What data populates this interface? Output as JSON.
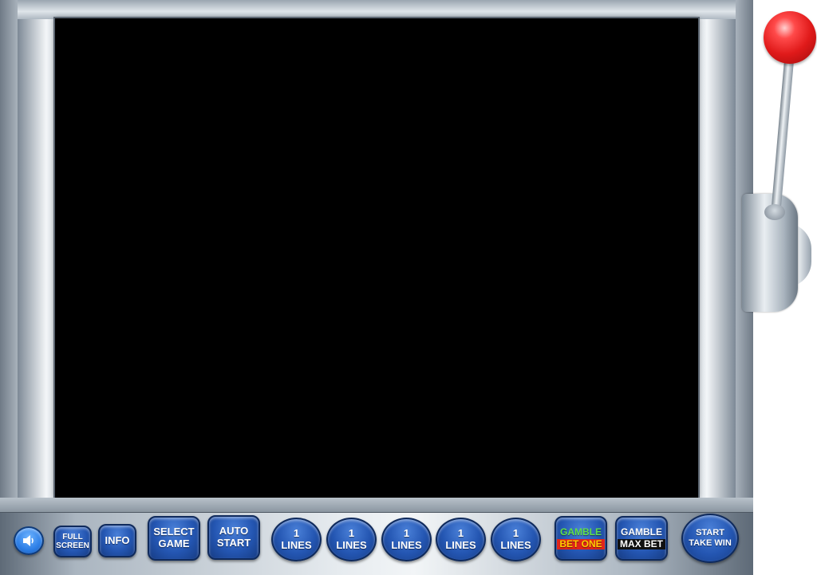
{
  "buttons": {
    "full_screen": [
      "FULL",
      "SCREEN"
    ],
    "info": "INFO",
    "select_game": [
      "SELECT",
      "GAME"
    ],
    "auto_start": [
      "AUTO",
      "START"
    ],
    "lines": [
      {
        "value": "1",
        "label": "LINES"
      },
      {
        "value": "1",
        "label": "LINES"
      },
      {
        "value": "1",
        "label": "LINES"
      },
      {
        "value": "1",
        "label": "LINES"
      },
      {
        "value": "1",
        "label": "LINES"
      }
    ],
    "gamble_bet_one": [
      "GAMBLE",
      "BET ONE"
    ],
    "gamble_max_bet": [
      "GAMBLE",
      "MAX BET"
    ],
    "start_take_win": [
      "START",
      "TAKE WIN"
    ]
  },
  "icons": {
    "sound": "speaker-icon",
    "lever": "slot-lever-icon"
  },
  "colors": {
    "button_blue": "#2456b2",
    "lever_red": "#e01a1a",
    "gamble_green": "#5fe04a",
    "bet_one_red": "#e0251a"
  }
}
